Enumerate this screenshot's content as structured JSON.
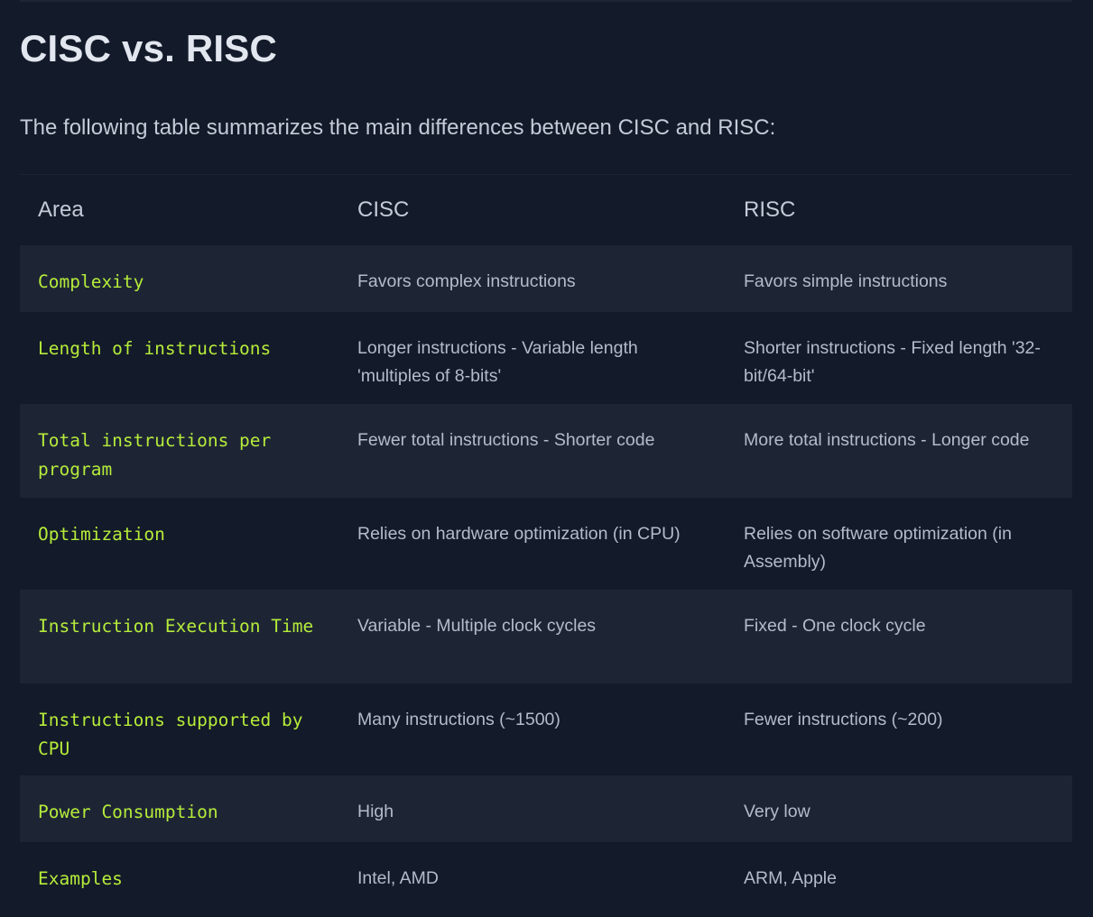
{
  "page": {
    "title": "CISC vs. RISC",
    "intro": "The following table summarizes the main differences between CISC and RISC:"
  },
  "table": {
    "headers": [
      "Area",
      "CISC",
      "RISC"
    ],
    "rows": [
      {
        "area": "Complexity",
        "cisc": "Favors complex instructions",
        "risc": "Favors simple instructions"
      },
      {
        "area": "Length of instructions",
        "cisc": "Longer instructions - Variable length 'multiples of 8-bits'",
        "risc": "Shorter instructions - Fixed length '32-bit/64-bit'"
      },
      {
        "area": "Total instructions per program",
        "cisc": "Fewer total instructions - Shorter code",
        "risc": "More total instructions - Longer code"
      },
      {
        "area": "Optimization",
        "cisc": "Relies on hardware optimization (in CPU)",
        "risc": "Relies on software optimization (in Assembly)"
      },
      {
        "area": "Instruction Execution Time",
        "cisc": "Variable - Multiple clock cycles",
        "risc": "Fixed - One clock cycle"
      },
      {
        "area": "Instructions supported by CPU",
        "cisc": "Many instructions (~1500)",
        "risc": "Fewer instructions (~200)"
      },
      {
        "area": "Power Consumption",
        "cisc": "High",
        "risc": "Very low"
      },
      {
        "area": "Examples",
        "cisc": "Intel, AMD",
        "risc": "ARM, Apple"
      }
    ]
  },
  "colors": {
    "background": "#131a29",
    "row_shade": "#1d2535",
    "area_accent": "#b6ec3a",
    "title": "#e1e6ef",
    "text": "#b3bccb"
  }
}
